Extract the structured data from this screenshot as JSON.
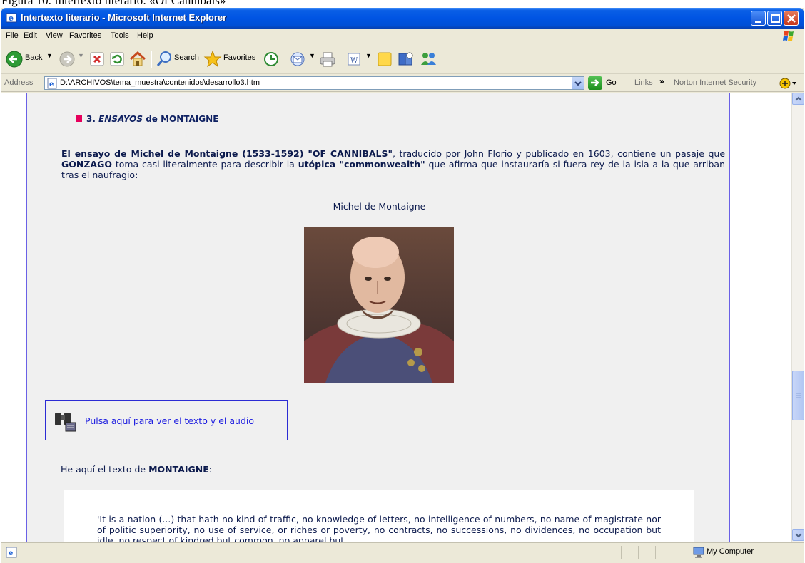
{
  "figure_caption": "Figura 10. Intertexto literario: «Of Cannibals»",
  "window": {
    "title": "Intertexto literario - Microsoft Internet Explorer"
  },
  "menu": {
    "items": [
      "File",
      "Edit",
      "View",
      "Favorites",
      "Tools",
      "Help"
    ]
  },
  "toolbar": {
    "back_label": "Back",
    "search_label": "Search",
    "favorites_label": "Favorites"
  },
  "address": {
    "label": "Address",
    "url": "D:\\ARCHIVOS\\tema_muestra\\contenidos\\desarrollo3.htm",
    "go_label": "Go",
    "links_label": "Links",
    "links_chevron": "»",
    "norton_label": "Norton Internet Security"
  },
  "page": {
    "section_number": "3.",
    "section_title_em": "ENSAYOS",
    "section_title_rest": "de MONTAIGNE",
    "para_b1": "El ensayo de Michel de Montaigne (1533-1592) \"OF CANNIBALS\"",
    "para_t1": ", traducido por John Florio y publicado en 1603, contiene un pasaje que ",
    "para_b2": "GONZAGO",
    "para_t2": " toma casi literalmente para describir la ",
    "para_b3": "utópica \"commonwealth\"",
    "para_t3": " que afirma que instauraría si fuera rey de la isla a la que arriban tras el naufragio:",
    "portrait_caption": "Michel de Montaigne",
    "link_text": "Pulsa aquí para ver el texto y el audio",
    "intro_prefix": "He aquí el texto de ",
    "intro_bold": "MONTAIGNE",
    "intro_suffix": ":",
    "quote_text": "'It is a nation (...) that hath no kind of traffic, no knowledge of letters, no intelligence of numbers, no name of magistrate nor of politic superiority, no use of service, or riches or poverty, no contracts, no successions, no dividences, no occupation but idle, no respect of kindred but common, no apparel but"
  },
  "status": {
    "zone": "My Computer"
  }
}
